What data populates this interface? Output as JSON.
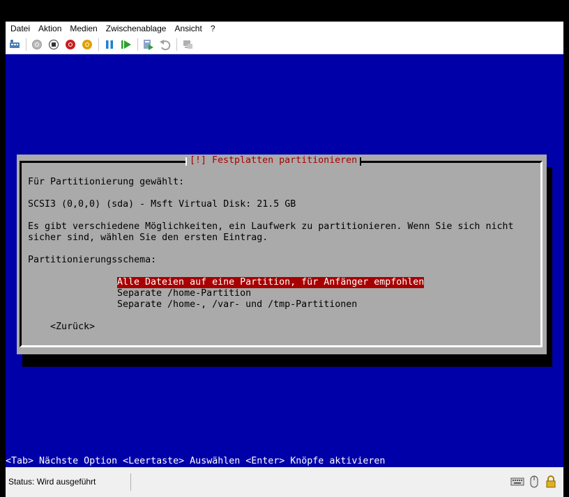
{
  "menubar": {
    "items": [
      "Datei",
      "Aktion",
      "Medien",
      "Zwischenablage",
      "Ansicht",
      "?"
    ]
  },
  "toolbar": {
    "icons": [
      "ctrl-alt-del-icon",
      "start-icon",
      "turn-off-icon",
      "shutdown-icon",
      "save-icon",
      "pause-icon",
      "reset-icon",
      "checkpoint-icon",
      "revert-icon",
      "enhanced-session-icon"
    ]
  },
  "screen": {
    "dialog_title": "[!] Festplatten partitionieren",
    "line1": "Für Partitionierung gewählt:",
    "line2": "SCSI3 (0,0,0) (sda) - Msft Virtual Disk: 21.5 GB",
    "line3": "Es gibt verschiedene Möglichkeiten, ein Laufwerk zu partitionieren. Wenn Sie sich nicht",
    "line4": "sicher sind, wählen Sie den ersten Eintrag.",
    "line5": "Partitionierungsschema:",
    "options": [
      "Alle Dateien auf eine Partition, für Anfänger empfohlen",
      "Separate /home-Partition",
      "Separate /home-, /var- und /tmp-Partitionen"
    ],
    "back_button": "<Zurück>",
    "hint": "<Tab> Nächste Option <Leertaste> Auswählen <Enter> Knöpfe aktivieren"
  },
  "statusbar": {
    "status": "Status: Wird ausgeführt"
  },
  "colors": {
    "screen_bg": "#0000a8",
    "dialog_bg": "#aaaaaa",
    "title_red": "#a80000",
    "selection_bg": "#a80000"
  }
}
